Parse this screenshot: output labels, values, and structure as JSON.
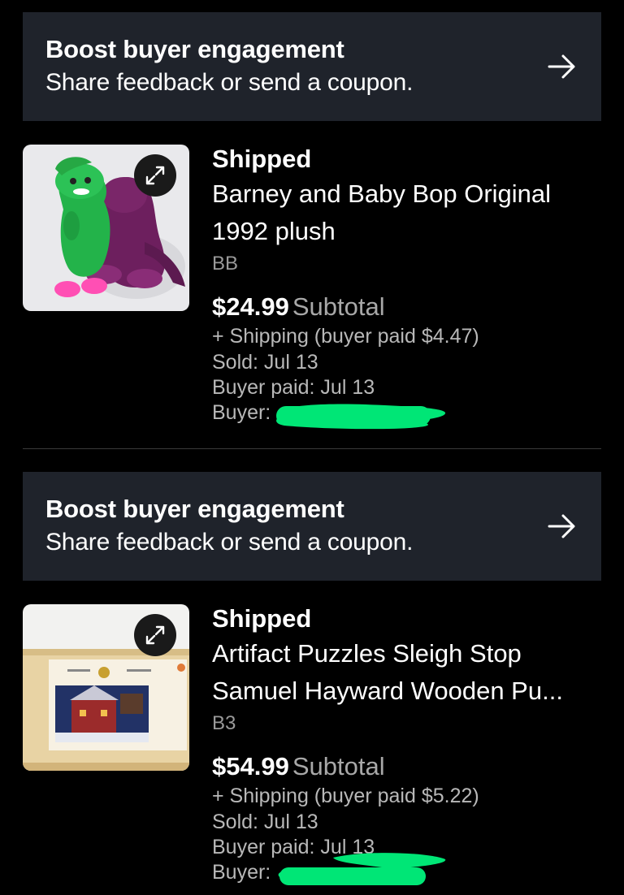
{
  "colors": {
    "background": "#000000",
    "banner_background": "#1f232b",
    "secondary_text": "#a8a8a8",
    "redaction": "#00e676"
  },
  "banners": [
    {
      "title": "Boost buyer engagement",
      "subtitle": "Share feedback or send a coupon.",
      "icon": "arrow-right-icon"
    },
    {
      "title": "Boost buyer engagement",
      "subtitle": "Share feedback or send a coupon.",
      "icon": "arrow-right-icon"
    }
  ],
  "orders": [
    {
      "status": "Shipped",
      "title_line1": "Barney and Baby Bop Original",
      "title_line2": "1992 plush",
      "sku": "BB",
      "price": "$24.99",
      "price_label": "Subtotal",
      "shipping": "+ Shipping (buyer paid $4.47)",
      "sold": "Sold: Jul 13",
      "buyer_paid": "Buyer paid: Jul 13",
      "buyer": "Buyer:",
      "image_icon": "plush-photo",
      "expand_icon": "expand-icon"
    },
    {
      "status": "Shipped",
      "title_line1": "Artifact Puzzles Sleigh Stop",
      "title_line2": "Samuel Hayward Wooden Pu...",
      "sku": "B3",
      "price": "$54.99",
      "price_label": "Subtotal",
      "shipping": "+ Shipping (buyer paid $5.22)",
      "sold": "Sold: Jul 13",
      "buyer_paid": "Buyer paid: Jul 13",
      "buyer": "Buyer:",
      "image_icon": "puzzle-photo",
      "expand_icon": "expand-icon"
    }
  ]
}
